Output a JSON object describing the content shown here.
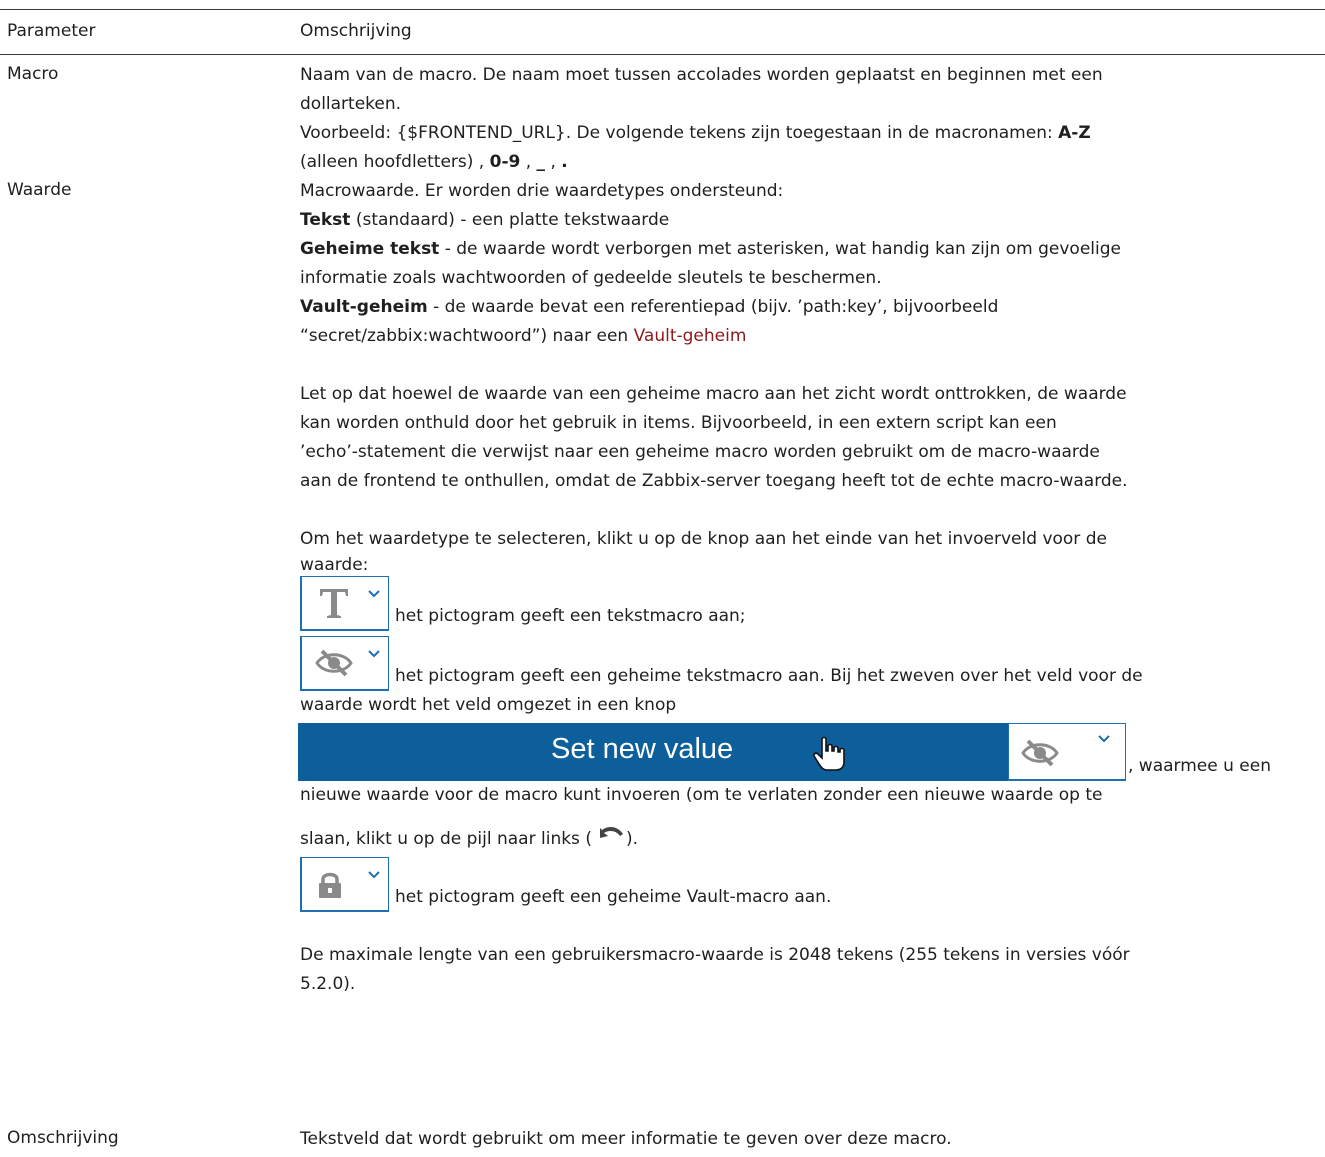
{
  "table": {
    "headers": [
      "Parameter",
      "Omschrijving"
    ],
    "rows": [
      {
        "name": "Macro",
        "lines": [
          "Naam van de macro. De naam moet tussen accolades worden geplaatst en beginnen met een",
          "dollarteken.",
          "Voorbeeld: {$FRONTEND_URL}. De volgende tekens zijn toegestaan in de macronamen: ",
          "A-Z",
          "(alleen hoofdletters) , ",
          "0-9",
          " , ",
          "_",
          " , ",
          "."
        ]
      },
      {
        "name": "Waarde",
        "intro": "Macrowaarde. Er worden drie waardetypes ondersteund:",
        "types": [
          {
            "bold": "Tekst",
            "text": " (standaard) - een platte tekstwaarde"
          },
          {
            "bold": "Geheime tekst",
            "text": " - de waarde wordt verborgen met asterisken, wat handig kan zijn om gevoelige",
            "text2": "informatie zoals wachtwoorden of gedeelde sleutels te beschermen."
          },
          {
            "bold": "Vault-geheim",
            "text": " - de waarde bevat een referentiepad (bijv. ’path:key’, bijvoorbeeld",
            "text2": "“secret/zabbix:wachtwoord”) naar een ",
            "link": "Vault-geheim"
          }
        ],
        "note_lines": [
          "Let op dat hoewel de waarde van een geheime macro aan het zicht wordt onttrokken, de waarde",
          "kan worden onthuld door het gebruik in items. Bijvoorbeeld, in een extern script kan een",
          "’echo’-statement die verwijst naar een geheime macro worden gebruikt om de macro-waarde",
          "aan de frontend te onthullen, omdat de Zabbix-server toegang heeft tot de echte macro-waarde."
        ],
        "select_lines": [
          "Om het waardetype te selecteren, klikt u op de knop aan het einde van het invoerveld voor de",
          "waarde:"
        ],
        "icon_text": "het pictogram geeft een tekstmacro aan;",
        "icon_secret": "het pictogram geeft een geheime tekstmacro aan. Bij het zweven over het veld voor de",
        "icon_secret2": "waarde wordt het veld omgezet in een knop",
        "set_new_value": "Set new value",
        "after_button": ", waarmee u een",
        "after_button2": "nieuwe waarde voor de macro kunt invoeren (om te verlaten zonder een nieuwe waarde op te",
        "revert_pre": "slaan, klikt u op de pijl naar links (",
        "revert_post": ").",
        "icon_vault": "het pictogram geeft een geheime Vault-macro aan.",
        "max_lines": [
          "De maximale lengte van een gebruikersmacro-waarde is 2048 tekens (255 tekens in versies vóór",
          "5.2.0)."
        ]
      },
      {
        "name": "Omschrijving",
        "text": "Tekstveld dat wordt gebruikt om meer informatie te geven over deze macro."
      }
    ]
  },
  "colors": {
    "link": "#8b1a1a",
    "button": "#0d5f9c",
    "icon_border": "#1f6fb3"
  }
}
